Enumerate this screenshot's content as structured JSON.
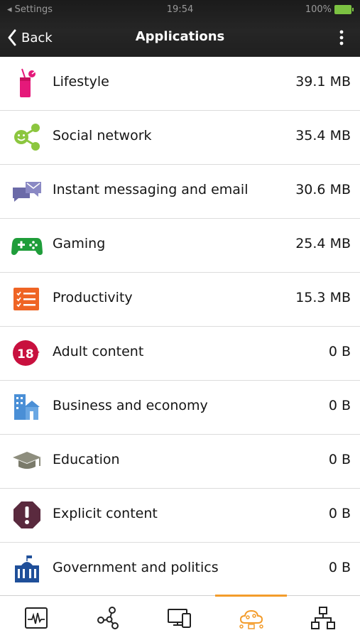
{
  "status_bar": {
    "carrier": "◂ Settings",
    "time": "19:54",
    "battery": "100%"
  },
  "nav": {
    "back_label": "Back",
    "title": "Applications"
  },
  "colors": {
    "accent": "#f39c2b",
    "lifestyle": "#e5197a",
    "social": "#8cc63f",
    "messaging": "#6b6aa8",
    "gaming": "#1f9d3a",
    "productivity": "#ef6424",
    "adult": "#c8103e",
    "business": "#4a8fd6",
    "education": "#8e8e7e",
    "explicit": "#5a2a3e",
    "government": "#1f4f99"
  },
  "categories": [
    {
      "name": "Lifestyle",
      "size": "39.1 MB",
      "icon": "cocktail-icon"
    },
    {
      "name": "Social network",
      "size": "35.4 MB",
      "icon": "social-network-icon"
    },
    {
      "name": "Instant messaging and email",
      "size": "30.6 MB",
      "icon": "chat-bubbles-icon"
    },
    {
      "name": "Gaming",
      "size": "25.4 MB",
      "icon": "gamepad-icon"
    },
    {
      "name": "Productivity",
      "size": "15.3 MB",
      "icon": "checklist-icon"
    },
    {
      "name": "Adult content",
      "size": "0 B",
      "icon": "eighteen-plus-icon"
    },
    {
      "name": "Business and economy",
      "size": "0 B",
      "icon": "buildings-icon"
    },
    {
      "name": "Education",
      "size": "0 B",
      "icon": "graduation-cap-icon"
    },
    {
      "name": "Explicit content",
      "size": "0 B",
      "icon": "warning-octagon-icon"
    },
    {
      "name": "Government and politics",
      "size": "0 B",
      "icon": "government-building-icon"
    }
  ],
  "tabs": [
    {
      "icon": "activity-monitor-icon",
      "active": false
    },
    {
      "icon": "share-nodes-icon",
      "active": false
    },
    {
      "icon": "devices-icon",
      "active": false
    },
    {
      "icon": "applications-cloud-icon",
      "active": true
    },
    {
      "icon": "network-topology-icon",
      "active": false
    }
  ]
}
